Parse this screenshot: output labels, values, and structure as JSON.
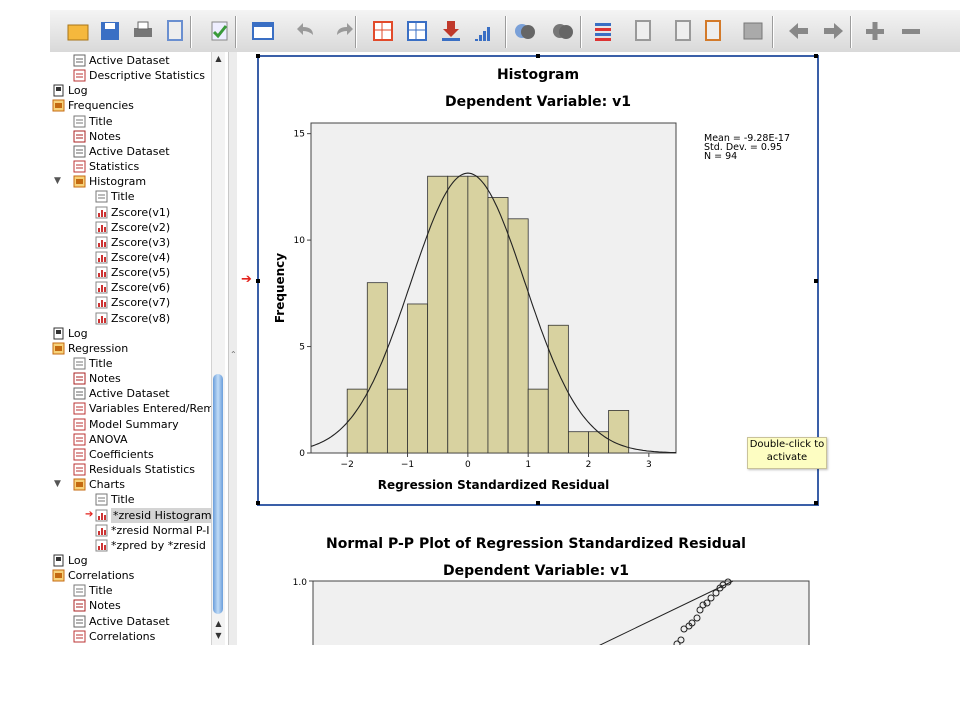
{
  "outline": {
    "items": [
      {
        "label": "Active Dataset",
        "indent": 1,
        "icon": "active-dataset-icon"
      },
      {
        "label": "Descriptive Statistics",
        "indent": 1,
        "icon": "table-icon"
      },
      {
        "label": "Log",
        "indent": 0,
        "icon": "log-icon"
      },
      {
        "label": "Frequencies",
        "indent": 0,
        "icon": "procedure-icon"
      },
      {
        "label": "Title",
        "indent": 1,
        "icon": "title-icon"
      },
      {
        "label": "Notes",
        "indent": 1,
        "icon": "notes-icon"
      },
      {
        "label": "Active Dataset",
        "indent": 1,
        "icon": "active-dataset-icon"
      },
      {
        "label": "Statistics",
        "indent": 1,
        "icon": "table-icon"
      },
      {
        "label": "Histogram",
        "indent": 1,
        "icon": "procedure-icon",
        "expanded": true
      },
      {
        "label": "Title",
        "indent": 2,
        "icon": "title-icon"
      },
      {
        "label": "Zscore(v1)",
        "indent": 2,
        "icon": "chart-icon"
      },
      {
        "label": "Zscore(v2)",
        "indent": 2,
        "icon": "chart-icon"
      },
      {
        "label": "Zscore(v3)",
        "indent": 2,
        "icon": "chart-icon"
      },
      {
        "label": "Zscore(v4)",
        "indent": 2,
        "icon": "chart-icon"
      },
      {
        "label": "Zscore(v5)",
        "indent": 2,
        "icon": "chart-icon"
      },
      {
        "label": "Zscore(v6)",
        "indent": 2,
        "icon": "chart-icon"
      },
      {
        "label": "Zscore(v7)",
        "indent": 2,
        "icon": "chart-icon"
      },
      {
        "label": "Zscore(v8)",
        "indent": 2,
        "icon": "chart-icon"
      },
      {
        "label": "Log",
        "indent": 0,
        "icon": "log-icon"
      },
      {
        "label": "Regression",
        "indent": 0,
        "icon": "procedure-icon"
      },
      {
        "label": "Title",
        "indent": 1,
        "icon": "title-icon"
      },
      {
        "label": "Notes",
        "indent": 1,
        "icon": "notes-icon"
      },
      {
        "label": "Active Dataset",
        "indent": 1,
        "icon": "active-dataset-icon"
      },
      {
        "label": "Variables Entered/Rem",
        "indent": 1,
        "icon": "table-icon"
      },
      {
        "label": "Model Summary",
        "indent": 1,
        "icon": "table-icon"
      },
      {
        "label": "ANOVA",
        "indent": 1,
        "icon": "table-icon"
      },
      {
        "label": "Coefficients",
        "indent": 1,
        "icon": "table-icon"
      },
      {
        "label": "Residuals Statistics",
        "indent": 1,
        "icon": "table-icon"
      },
      {
        "label": "Charts",
        "indent": 1,
        "icon": "procedure-icon",
        "expanded": true
      },
      {
        "label": "Title",
        "indent": 2,
        "icon": "title-icon"
      },
      {
        "label": "*zresid Histogram",
        "indent": 2,
        "icon": "chart-icon",
        "selected": true
      },
      {
        "label": "*zresid Normal P-I",
        "indent": 2,
        "icon": "chart-icon"
      },
      {
        "label": "*zpred by *zresid",
        "indent": 2,
        "icon": "chart-icon"
      },
      {
        "label": "Log",
        "indent": 0,
        "icon": "log-icon"
      },
      {
        "label": "Correlations",
        "indent": 0,
        "icon": "procedure-icon"
      },
      {
        "label": "Title",
        "indent": 1,
        "icon": "title-icon"
      },
      {
        "label": "Notes",
        "indent": 1,
        "icon": "notes-icon"
      },
      {
        "label": "Active Dataset",
        "indent": 1,
        "icon": "active-dataset-icon"
      },
      {
        "label": "Correlations",
        "indent": 1,
        "icon": "table-icon"
      }
    ]
  },
  "toolbar": {
    "buttons": [
      "open-folder-icon",
      "save-icon",
      "print-icon",
      "print-preview-icon",
      "export-icon",
      "dialog-recall-icon",
      "undo-icon",
      "redo-icon",
      "goto-data-icon",
      "goto-case-icon",
      "goto-variable-icon",
      "variables-icon",
      "select-output-icon",
      "hide-output-icon",
      "designate-window-icon",
      "promote-icon",
      "demote-icon",
      "insert-icon",
      "insert-heading-icon",
      "back-icon",
      "forward-icon",
      "expand-icon",
      "collapse-icon"
    ]
  },
  "colors": {
    "bar_fill": "#d8d2a0",
    "plot_bg": "#f0f0f0",
    "frame": "#3a5fa8",
    "accent_arrow": "#e3211b",
    "tooltip_bg": "#fdfdc2"
  },
  "histogram": {
    "title": "Histogram",
    "subtitle": "Dependent Variable: v1",
    "stats": [
      "Mean = -9.28E-17",
      "Std. Dev. = 0.95",
      "N = 94"
    ],
    "tooltip": "Double-click to activate"
  },
  "pp_plot": {
    "title": "Normal P-P Plot of Regression Standardized Residual",
    "subtitle": "Dependent Variable: v1",
    "y_tick": "1.0"
  },
  "chart_data": [
    {
      "type": "bar",
      "title": "Histogram",
      "subtitle": "Dependent Variable: v1",
      "xlabel": "Regression Standardized Residual",
      "ylabel": "Frequency",
      "bin_width": 0.333,
      "bin_starts": [
        -2.0,
        -1.667,
        -1.333,
        -1.0,
        -0.667,
        -0.333,
        0.0,
        0.333,
        0.667,
        1.0,
        1.333,
        1.667,
        2.0,
        2.333
      ],
      "values": [
        3,
        8,
        3,
        7,
        13,
        13,
        13,
        12,
        11,
        3,
        6,
        1,
        1,
        2
      ],
      "normal_curve": {
        "mean": 0.0,
        "sd": 0.95,
        "n": 94
      },
      "xlim": [
        -2.6,
        3.45
      ],
      "ylim": [
        0,
        15.5
      ],
      "xticks": [
        -2,
        -1,
        0,
        1,
        2,
        3
      ],
      "yticks": [
        0,
        5,
        10,
        15
      ],
      "grid": false
    },
    {
      "type": "scatter",
      "title": "Normal P-P Plot of Regression Standardized Residual",
      "subtitle": "Dependent Variable: v1",
      "yticks": [
        1.0
      ],
      "partial": true
    }
  ]
}
